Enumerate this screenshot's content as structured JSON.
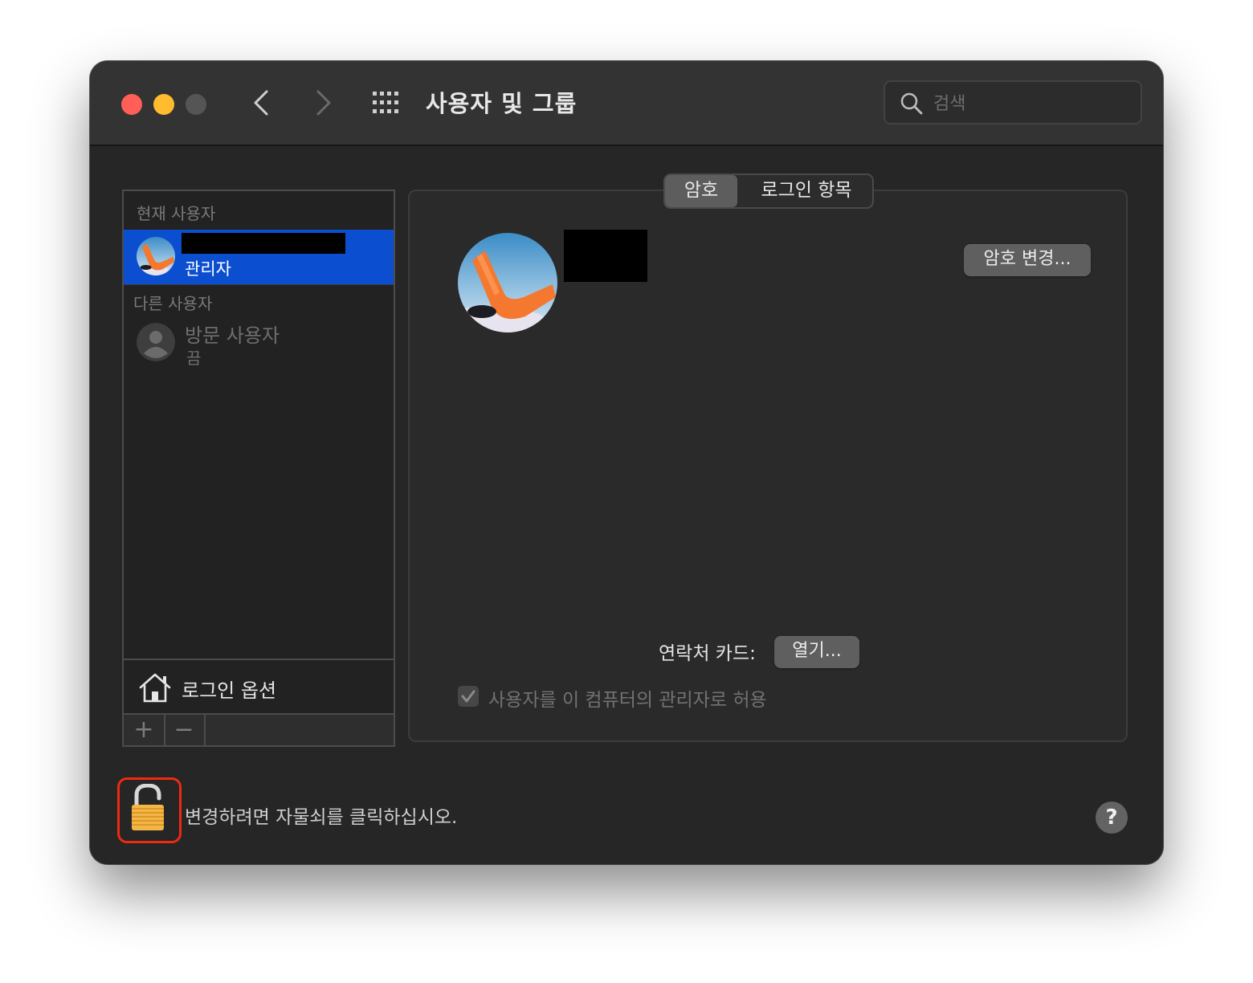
{
  "window": {
    "title": "사용자 및 그룹",
    "search_placeholder": "검색"
  },
  "sidebar": {
    "current_users_header": "현재 사용자",
    "current_user_role": "관리자",
    "other_users_header": "다른 사용자",
    "guest_name": "방문 사용자",
    "guest_status": "끔",
    "login_options_label": "로그인 옵션",
    "add_label": "+",
    "remove_label": "−"
  },
  "tabs": [
    {
      "label": "암호",
      "selected": true
    },
    {
      "label": "로그인 항목",
      "selected": false
    }
  ],
  "panel": {
    "change_password_label": "암호 변경...",
    "contact_card_label": "연락처 카드:",
    "open_label": "열기...",
    "allow_admin_label": "사용자를 이 컴퓨터의 관리자로 허용",
    "allow_admin_checked": true
  },
  "footer": {
    "lock_text": "변경하려면 자물쇠를 클릭하십시오.",
    "help_label": "?"
  },
  "colors": {
    "window_bg": "#262626",
    "selection": "#0b4fd0",
    "close": "#ff5f57",
    "minimize": "#febc2e",
    "lock_highlight": "#ee2a12",
    "lock_body": "#f4b547"
  }
}
